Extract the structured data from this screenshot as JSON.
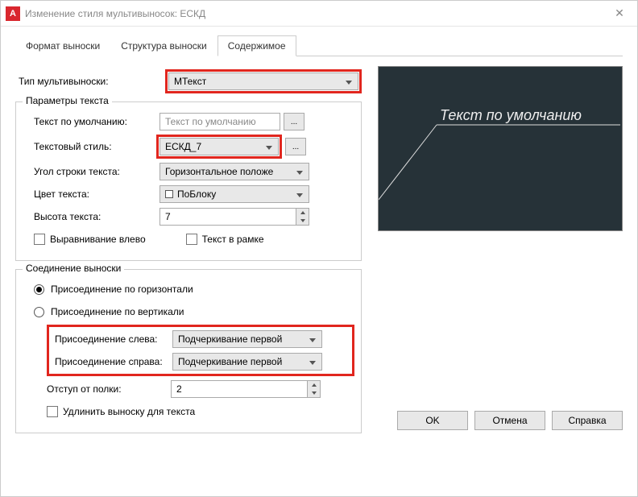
{
  "window": {
    "title": "Изменение стиля мультивыносок: ЕСКД",
    "appicon": "A"
  },
  "tabs": {
    "t1": "Формат выноски",
    "t2": "Структура выноски",
    "t3": "Содержимое"
  },
  "leader_type_label": "Тип мультивыноски:",
  "leader_type_value": "МТекст",
  "text_params_legend": "Параметры текста",
  "default_text_label": "Текст по умолчанию:",
  "default_text_placeholder": "Текст по умолчанию",
  "ellipsis": "...",
  "text_style_label": "Текстовый стиль:",
  "text_style_value": "ЕСКД_7",
  "text_angle_label": "Угол строки текста:",
  "text_angle_value": "Горизонтальное положе",
  "text_color_label": "Цвет текста:",
  "text_color_value": "ПоБлоку",
  "text_height_label": "Высота текста:",
  "text_height_value": "7",
  "left_align_label": "Выравнивание влево",
  "text_frame_label": "Текст в рамке",
  "conn_legend": "Соединение выноски",
  "attach_horiz": "Присоединение по горизонтали",
  "attach_vert": "Присоединение по вертикали",
  "attach_left_label": "Присоединение слева:",
  "attach_left_value": "Подчеркивание первой",
  "attach_right_label": "Присоединение справа:",
  "attach_right_value": "Подчеркивание первой",
  "landing_gap_label": "Отступ от полки:",
  "landing_gap_value": "2",
  "extend_leader": "Удлинить выноску для текста",
  "preview_text": "Текст по умолчанию",
  "buttons": {
    "ok": "OK",
    "cancel": "Отмена",
    "help": "Справка"
  }
}
